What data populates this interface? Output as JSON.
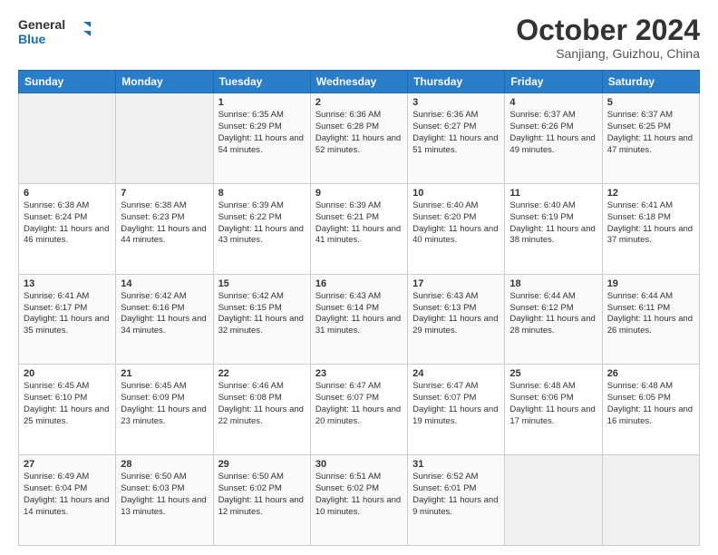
{
  "header": {
    "logo_line1": "General",
    "logo_line2": "Blue",
    "main_title": "October 2024",
    "subtitle": "Sanjiang, Guizhou, China"
  },
  "days_of_week": [
    "Sunday",
    "Monday",
    "Tuesday",
    "Wednesday",
    "Thursday",
    "Friday",
    "Saturday"
  ],
  "weeks": [
    [
      {
        "day": "",
        "info": ""
      },
      {
        "day": "",
        "info": ""
      },
      {
        "day": "1",
        "info": "Sunrise: 6:35 AM\nSunset: 6:29 PM\nDaylight: 11 hours and 54 minutes."
      },
      {
        "day": "2",
        "info": "Sunrise: 6:36 AM\nSunset: 6:28 PM\nDaylight: 11 hours and 52 minutes."
      },
      {
        "day": "3",
        "info": "Sunrise: 6:36 AM\nSunset: 6:27 PM\nDaylight: 11 hours and 51 minutes."
      },
      {
        "day": "4",
        "info": "Sunrise: 6:37 AM\nSunset: 6:26 PM\nDaylight: 11 hours and 49 minutes."
      },
      {
        "day": "5",
        "info": "Sunrise: 6:37 AM\nSunset: 6:25 PM\nDaylight: 11 hours and 47 minutes."
      }
    ],
    [
      {
        "day": "6",
        "info": "Sunrise: 6:38 AM\nSunset: 6:24 PM\nDaylight: 11 hours and 46 minutes."
      },
      {
        "day": "7",
        "info": "Sunrise: 6:38 AM\nSunset: 6:23 PM\nDaylight: 11 hours and 44 minutes."
      },
      {
        "day": "8",
        "info": "Sunrise: 6:39 AM\nSunset: 6:22 PM\nDaylight: 11 hours and 43 minutes."
      },
      {
        "day": "9",
        "info": "Sunrise: 6:39 AM\nSunset: 6:21 PM\nDaylight: 11 hours and 41 minutes."
      },
      {
        "day": "10",
        "info": "Sunrise: 6:40 AM\nSunset: 6:20 PM\nDaylight: 11 hours and 40 minutes."
      },
      {
        "day": "11",
        "info": "Sunrise: 6:40 AM\nSunset: 6:19 PM\nDaylight: 11 hours and 38 minutes."
      },
      {
        "day": "12",
        "info": "Sunrise: 6:41 AM\nSunset: 6:18 PM\nDaylight: 11 hours and 37 minutes."
      }
    ],
    [
      {
        "day": "13",
        "info": "Sunrise: 6:41 AM\nSunset: 6:17 PM\nDaylight: 11 hours and 35 minutes."
      },
      {
        "day": "14",
        "info": "Sunrise: 6:42 AM\nSunset: 6:16 PM\nDaylight: 11 hours and 34 minutes."
      },
      {
        "day": "15",
        "info": "Sunrise: 6:42 AM\nSunset: 6:15 PM\nDaylight: 11 hours and 32 minutes."
      },
      {
        "day": "16",
        "info": "Sunrise: 6:43 AM\nSunset: 6:14 PM\nDaylight: 11 hours and 31 minutes."
      },
      {
        "day": "17",
        "info": "Sunrise: 6:43 AM\nSunset: 6:13 PM\nDaylight: 11 hours and 29 minutes."
      },
      {
        "day": "18",
        "info": "Sunrise: 6:44 AM\nSunset: 6:12 PM\nDaylight: 11 hours and 28 minutes."
      },
      {
        "day": "19",
        "info": "Sunrise: 6:44 AM\nSunset: 6:11 PM\nDaylight: 11 hours and 26 minutes."
      }
    ],
    [
      {
        "day": "20",
        "info": "Sunrise: 6:45 AM\nSunset: 6:10 PM\nDaylight: 11 hours and 25 minutes."
      },
      {
        "day": "21",
        "info": "Sunrise: 6:45 AM\nSunset: 6:09 PM\nDaylight: 11 hours and 23 minutes."
      },
      {
        "day": "22",
        "info": "Sunrise: 6:46 AM\nSunset: 6:08 PM\nDaylight: 11 hours and 22 minutes."
      },
      {
        "day": "23",
        "info": "Sunrise: 6:47 AM\nSunset: 6:07 PM\nDaylight: 11 hours and 20 minutes."
      },
      {
        "day": "24",
        "info": "Sunrise: 6:47 AM\nSunset: 6:07 PM\nDaylight: 11 hours and 19 minutes."
      },
      {
        "day": "25",
        "info": "Sunrise: 6:48 AM\nSunset: 6:06 PM\nDaylight: 11 hours and 17 minutes."
      },
      {
        "day": "26",
        "info": "Sunrise: 6:48 AM\nSunset: 6:05 PM\nDaylight: 11 hours and 16 minutes."
      }
    ],
    [
      {
        "day": "27",
        "info": "Sunrise: 6:49 AM\nSunset: 6:04 PM\nDaylight: 11 hours and 14 minutes."
      },
      {
        "day": "28",
        "info": "Sunrise: 6:50 AM\nSunset: 6:03 PM\nDaylight: 11 hours and 13 minutes."
      },
      {
        "day": "29",
        "info": "Sunrise: 6:50 AM\nSunset: 6:02 PM\nDaylight: 11 hours and 12 minutes."
      },
      {
        "day": "30",
        "info": "Sunrise: 6:51 AM\nSunset: 6:02 PM\nDaylight: 11 hours and 10 minutes."
      },
      {
        "day": "31",
        "info": "Sunrise: 6:52 AM\nSunset: 6:01 PM\nDaylight: 11 hours and 9 minutes."
      },
      {
        "day": "",
        "info": ""
      },
      {
        "day": "",
        "info": ""
      }
    ]
  ]
}
